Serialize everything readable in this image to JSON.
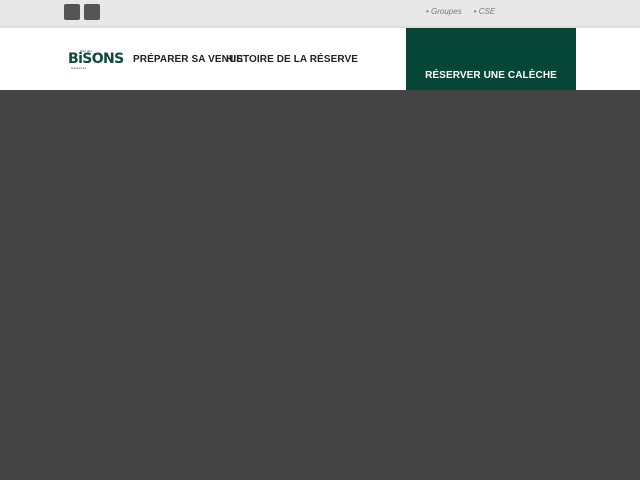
{
  "topbar": {
    "social_icons": [
      "facebook-icon",
      "instagram-icon"
    ],
    "links": [
      "• Groupes",
      "• CSE"
    ]
  },
  "logo": {
    "superscript": "Parc des",
    "main": "BiSONS",
    "subtitle": "Calèches"
  },
  "nav": {
    "items": [
      "PRÉPARER SA VENUE",
      "HISTOIRE DE LA RÉSERVE"
    ]
  },
  "cta": {
    "label": "RÉSERVER UNE CALÈCHE"
  },
  "colors": {
    "brand_green": "#054637",
    "topbar_bg": "#e8e8e8",
    "content_bg": "#444444"
  }
}
